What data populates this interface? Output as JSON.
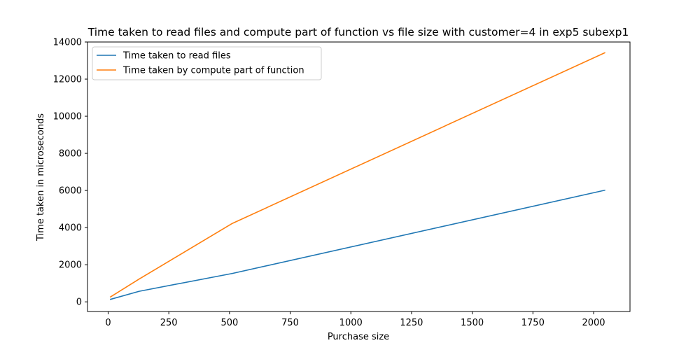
{
  "chart_data": {
    "type": "line",
    "title": "Time taken to read files and compute part of function vs file size with customer=4 in exp5 subexp1",
    "xlabel": "Purchase size",
    "ylabel": "Time taken in microseconds",
    "xlim": [
      -85,
      2150
    ],
    "ylim": [
      -520,
      14000
    ],
    "xticks": [
      0,
      250,
      500,
      750,
      1000,
      1250,
      1500,
      1750,
      2000
    ],
    "yticks": [
      0,
      2000,
      4000,
      6000,
      8000,
      10000,
      12000,
      14000
    ],
    "grid": false,
    "legend_position": "upper-left",
    "x": [
      8,
      128,
      512,
      2048
    ],
    "series": [
      {
        "name": "Time taken to read files",
        "color": "#1f77b4",
        "values": [
          130,
          570,
          1530,
          6020
        ]
      },
      {
        "name": "Time taken by compute part of function",
        "color": "#ff7f0e",
        "values": [
          250,
          1230,
          4230,
          13430
        ]
      }
    ]
  }
}
